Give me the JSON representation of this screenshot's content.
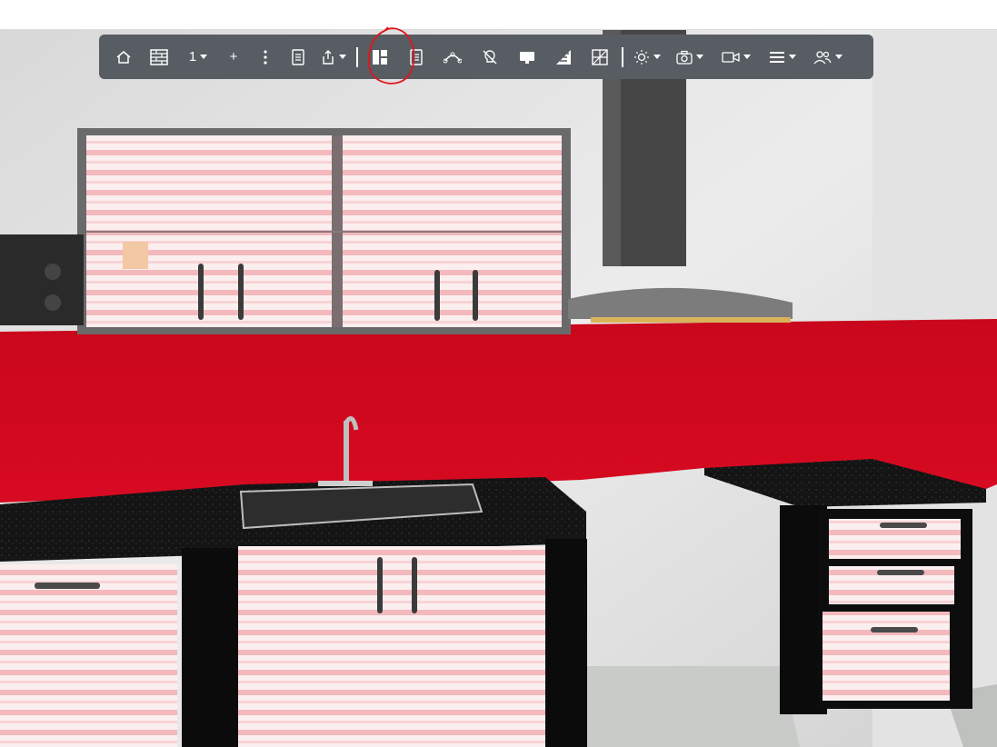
{
  "toolbar": {
    "level_label": "1",
    "plus_label": "+",
    "items": [
      {
        "name": "home-icon"
      },
      {
        "name": "wall-icon"
      },
      {
        "name": "level-select"
      },
      {
        "name": "add-level-button"
      },
      {
        "name": "more-options-icon"
      },
      {
        "name": "document-icon"
      },
      {
        "name": "export-icon"
      },
      {
        "name": "layout-icon"
      },
      {
        "name": "notes-icon"
      },
      {
        "name": "path-icon"
      },
      {
        "name": "light-off-icon"
      },
      {
        "name": "display-icon"
      },
      {
        "name": "stairs-icon"
      },
      {
        "name": "grid-icon"
      },
      {
        "name": "sun-icon"
      },
      {
        "name": "camera-icon"
      },
      {
        "name": "video-icon"
      },
      {
        "name": "menu-icon"
      },
      {
        "name": "users-icon"
      }
    ]
  },
  "colors": {
    "toolbar_bg": "#575d63",
    "backsplash": "#d0081f",
    "counter": "#111111",
    "annotation": "#e0161d"
  }
}
